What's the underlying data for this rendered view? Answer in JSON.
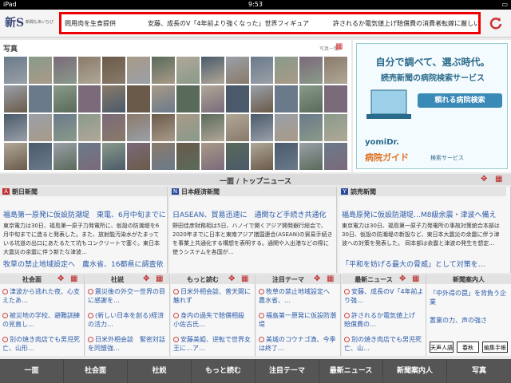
{
  "status": {
    "device": "iPad",
    "time": "9:53"
  },
  "header": {
    "logo_text": "新S",
    "logo_sub": "新聞もあいちび",
    "ticker": [
      "問用肉を生食提供",
      "安藤、成長のV「4年前より強くなった」世界フィギュア",
      "許されるか電気値上げ",
      "賠償費の消費者転嫁に厳しい"
    ]
  },
  "photos": {
    "title": "写真",
    "more": "写真一覧"
  },
  "ad": {
    "line1": "自分で調べて、選ぶ時代。",
    "line2": "読売新聞の病院検索サービス",
    "button": "頼れる病院検索",
    "brand": "yomiDr.",
    "guide": "病院ガイド",
    "guide_sub": "検索サービス"
  },
  "section_title": "一面 / トップニュース",
  "papers": [
    {
      "name": "朝日新聞",
      "logo": "A",
      "logo_color": "#c03030",
      "headline": "福島第一原発に仮設防潮堤　東電、6月中旬までに",
      "body": "東京電力は30日、福島第一原子力発電所に、仮設の防潮堤を6月中旬までに造ると発表した。また、放射能汚染水がたまっている坑道の出口にあたるたて坑もコンクリートで塞ぐ。東日本大震災の余震に伴う新たな津波…",
      "headline2": "牧草の禁止地域設定へ　農水省、16都県に調査依"
    },
    {
      "name": "日本経済新聞",
      "logo": "N",
      "logo_color": "#2a4a9a",
      "headline": "日ASEAN、貿易迅速に　通関など手続き共通化",
      "body": "野田佳彦財務相は5日、ハノイで開くアジア開発銀行総会で、2020年までに日本と東南アジア諸国連合(ASEAN)の貿易手続きを事業上共通化する構想を表明する。通関や入出港などの際に使うシステムを各国が…",
      "headline2": ""
    },
    {
      "name": "読売新聞",
      "logo": "Y",
      "logo_color": "#2a4a9a",
      "headline": "福島原発に仮設防潮堤…M8級余震・津波へ備え",
      "body": "東京電力は30日、福島第一原子力発電所の事故対策統合本部は30日、仮設の防潮堤の新設など、東日本大震災の余震に伴う津波への対策を発表した。 同本部は余震と津波の発生を想定…",
      "headline2": "「平和を妨げる最大の脅威」として対策を…"
    }
  ],
  "columns": [
    {
      "name": "社会面",
      "items": [
        "津波から逃れた夜、心支えたあ…",
        "被災地の学校、避難訓練の見直し…",
        "別の焼き肉店でも男児死亡、山形…"
      ]
    },
    {
      "name": "社説",
      "items": [
        "震災後の外交一世界の目に感謝を…",
        "(新しい日本を創る)経済の活力…",
        "日米外相会談　緊密対話を同盟強…"
      ]
    },
    {
      "name": "もっと読む",
      "items": [
        "日米外相会談、普天間に触れず",
        "身内の過失で賠償相殺　小佐古氏…",
        "安藤美姫、逆転で世界女王に…ア…"
      ]
    },
    {
      "name": "注目テーマ",
      "items": [
        "牧草の禁止地域設定へ　農水省、…",
        "福島第一原発に仮設防潮堤",
        "美城のコウナゴ漁、今季は終了…"
      ]
    },
    {
      "name": "最新ニュース",
      "items": [
        "安藤、成長のV「4年前より強…",
        "許されるか電気値上げ　賠償費の…",
        "別の焼き肉店でも男児死亡、山…"
      ]
    }
  ],
  "guide": {
    "name": "新聞案内人",
    "items": [
      "「中外得の罠」を背負う企業",
      "置業の力、声の強さ"
    ],
    "badges": [
      "天声人語",
      "春秋",
      "編集手帳"
    ]
  },
  "tabs": [
    "一面",
    "社会面",
    "社説",
    "もっと読む",
    "注目テーマ",
    "最新ニュース",
    "新聞案内人",
    "写真"
  ]
}
